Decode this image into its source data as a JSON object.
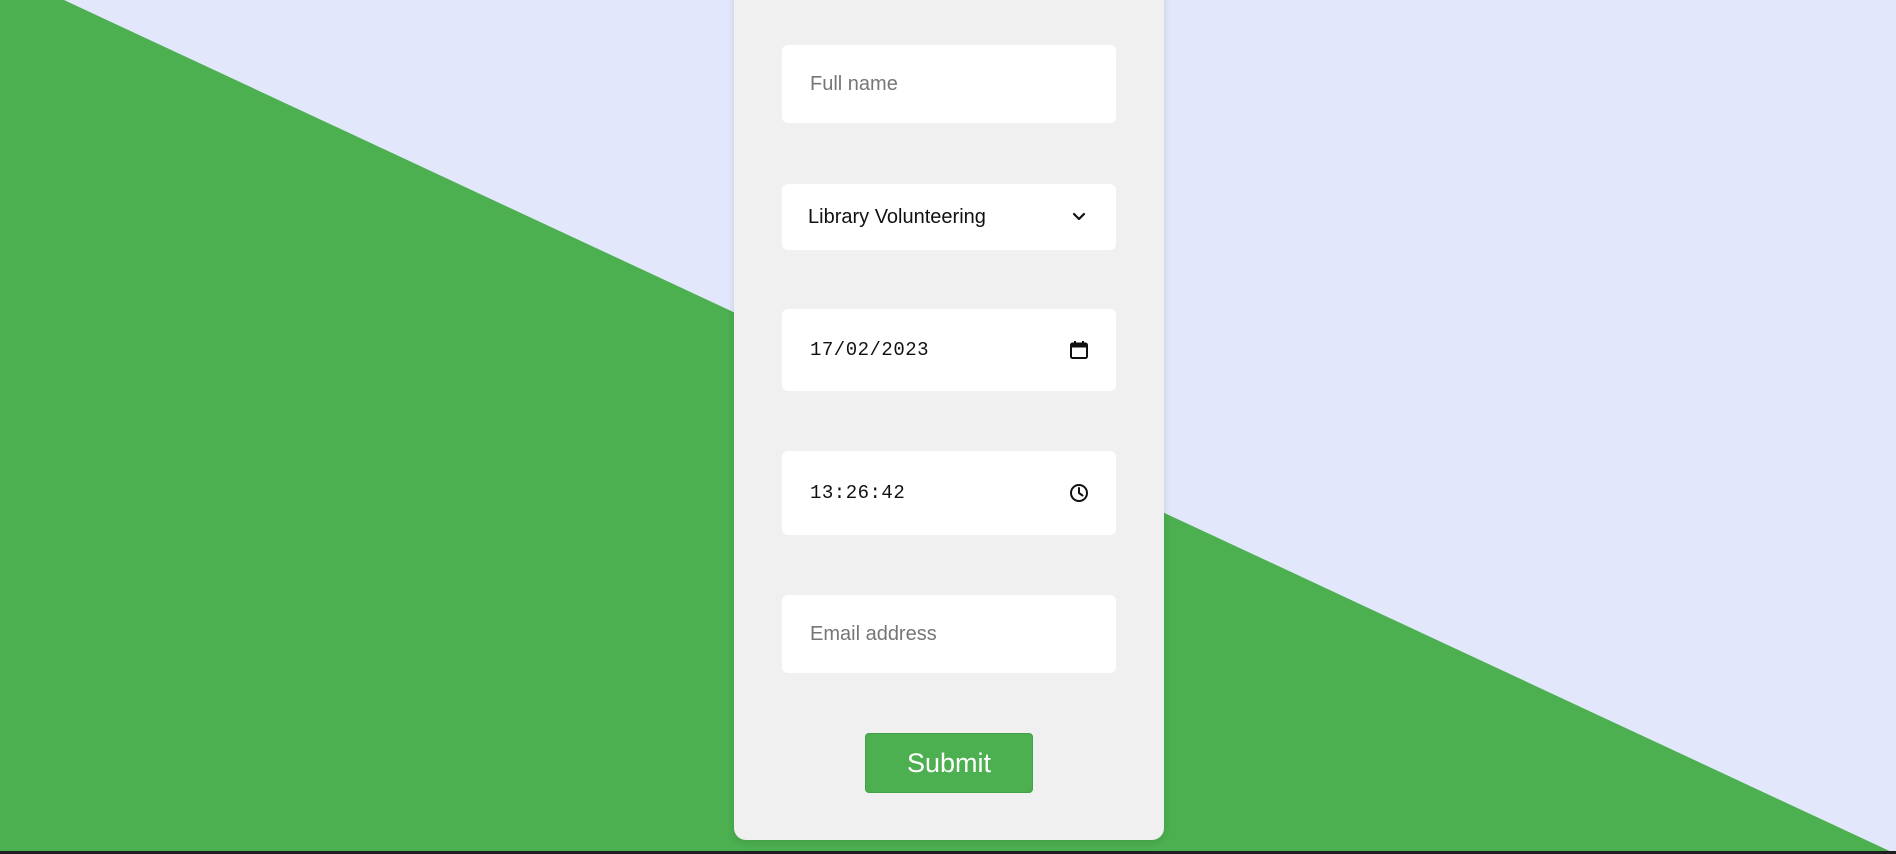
{
  "colors": {
    "background_light": "#e3e7fb",
    "background_green": "#4caf50",
    "card": "#f0f0f0",
    "button": "#4caf50",
    "button_text": "#ffffff"
  },
  "form": {
    "name": {
      "placeholder": "Full name",
      "value": ""
    },
    "activity": {
      "selected": "Library Volunteering",
      "icon": "chevron-down-icon"
    },
    "date": {
      "value": "17/02/2023",
      "icon": "calendar-icon"
    },
    "time": {
      "value": "13:26:42",
      "icon": "clock-icon"
    },
    "email": {
      "placeholder": "Email address",
      "value": ""
    },
    "submit_label": "Submit"
  }
}
